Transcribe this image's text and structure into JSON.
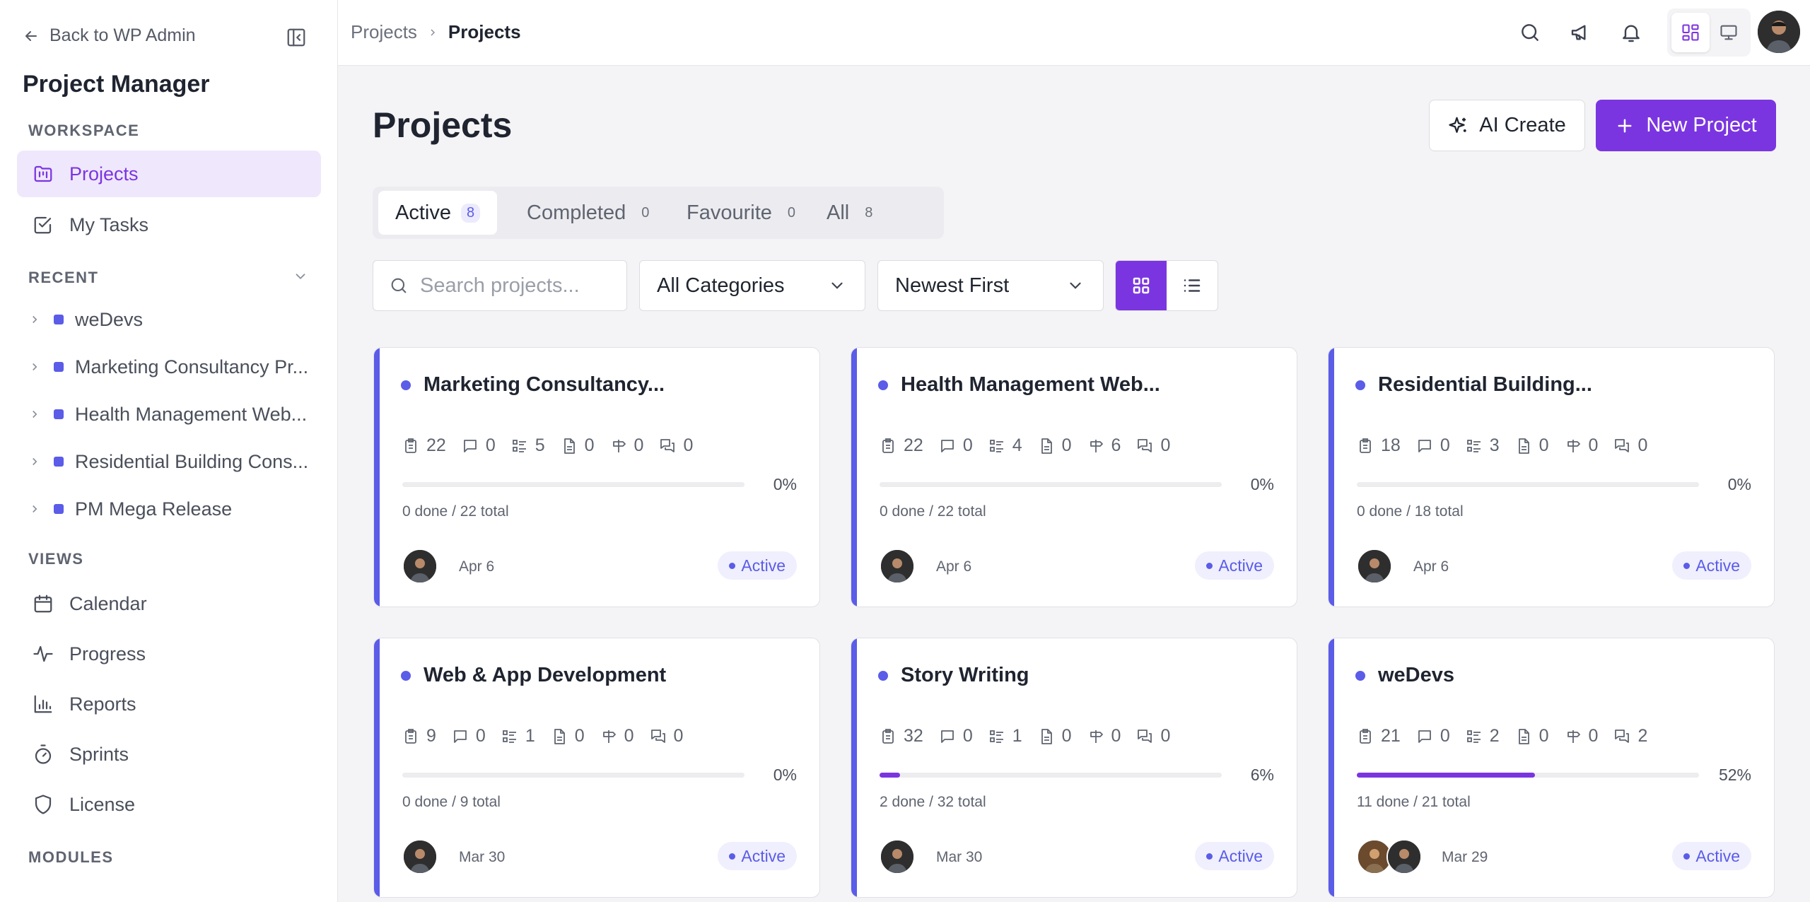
{
  "sidebar": {
    "back_label": "Back to WP Admin",
    "app_title": "Project Manager",
    "workspace_label": "WORKSPACE",
    "workspace_items": [
      {
        "label": "Projects",
        "icon": "folder-kanban-icon",
        "active": true
      },
      {
        "label": "My Tasks",
        "icon": "checkbox-icon",
        "active": false
      }
    ],
    "recent_label": "RECENT",
    "recent_items": [
      "weDevs",
      "Marketing Consultancy Pr...",
      "Health Management Web...",
      "Residential Building Cons...",
      "PM Mega Release"
    ],
    "views_label": "VIEWS",
    "view_items": [
      {
        "label": "Calendar",
        "icon": "calendar-icon"
      },
      {
        "label": "Progress",
        "icon": "activity-icon"
      },
      {
        "label": "Reports",
        "icon": "bar-chart-icon"
      },
      {
        "label": "Sprints",
        "icon": "timer-icon"
      },
      {
        "label": "License",
        "icon": "shield-icon"
      }
    ],
    "modules_label": "MODULES"
  },
  "topbar": {
    "breadcrumb": [
      "Projects",
      "Projects"
    ]
  },
  "main": {
    "title": "Projects",
    "ai_create_label": "AI Create",
    "new_project_label": "New Project",
    "tabs": [
      {
        "label": "Active",
        "count": "8"
      },
      {
        "label": "Completed",
        "count": "0"
      },
      {
        "label": "Favourite",
        "count": "0"
      },
      {
        "label": "All",
        "count": "8"
      }
    ],
    "search_placeholder": "Search projects...",
    "category_select": "All Categories",
    "sort_select": "Newest First"
  },
  "colors": {
    "accent": "#7b35e0",
    "card_stripe": "#5b5ce8",
    "active_nav_bg": "#efe7fc"
  },
  "projects": [
    {
      "title": "Marketing Consultancy...",
      "tasks": "22",
      "comments": "0",
      "lists": "5",
      "files": "0",
      "milestones": "0",
      "discussions": "0",
      "progress_pct": 0,
      "pct_label": "0%",
      "done_label": "0 done / 22 total",
      "date": "Apr 6",
      "status": "Active",
      "members": 1
    },
    {
      "title": "Health Management Web...",
      "tasks": "22",
      "comments": "0",
      "lists": "4",
      "files": "0",
      "milestones": "6",
      "discussions": "0",
      "progress_pct": 0,
      "pct_label": "0%",
      "done_label": "0 done / 22 total",
      "date": "Apr 6",
      "status": "Active",
      "members": 1
    },
    {
      "title": "Residential Building...",
      "tasks": "18",
      "comments": "0",
      "lists": "3",
      "files": "0",
      "milestones": "0",
      "discussions": "0",
      "progress_pct": 0,
      "pct_label": "0%",
      "done_label": "0 done / 18 total",
      "date": "Apr 6",
      "status": "Active",
      "members": 1
    },
    {
      "title": "Web & App Development",
      "tasks": "9",
      "comments": "0",
      "lists": "1",
      "files": "0",
      "milestones": "0",
      "discussions": "0",
      "progress_pct": 0,
      "pct_label": "0%",
      "done_label": "0 done / 9 total",
      "date": "Mar 30",
      "status": "Active",
      "members": 1
    },
    {
      "title": "Story Writing",
      "tasks": "32",
      "comments": "0",
      "lists": "1",
      "files": "0",
      "milestones": "0",
      "discussions": "0",
      "progress_pct": 6,
      "pct_label": "6%",
      "done_label": "2 done / 32 total",
      "date": "Mar 30",
      "status": "Active",
      "members": 1
    },
    {
      "title": "weDevs",
      "tasks": "21",
      "comments": "0",
      "lists": "2",
      "files": "0",
      "milestones": "0",
      "discussions": "2",
      "progress_pct": 52,
      "pct_label": "52%",
      "done_label": "11 done / 21 total",
      "date": "Mar 29",
      "status": "Active",
      "members": 2
    }
  ]
}
